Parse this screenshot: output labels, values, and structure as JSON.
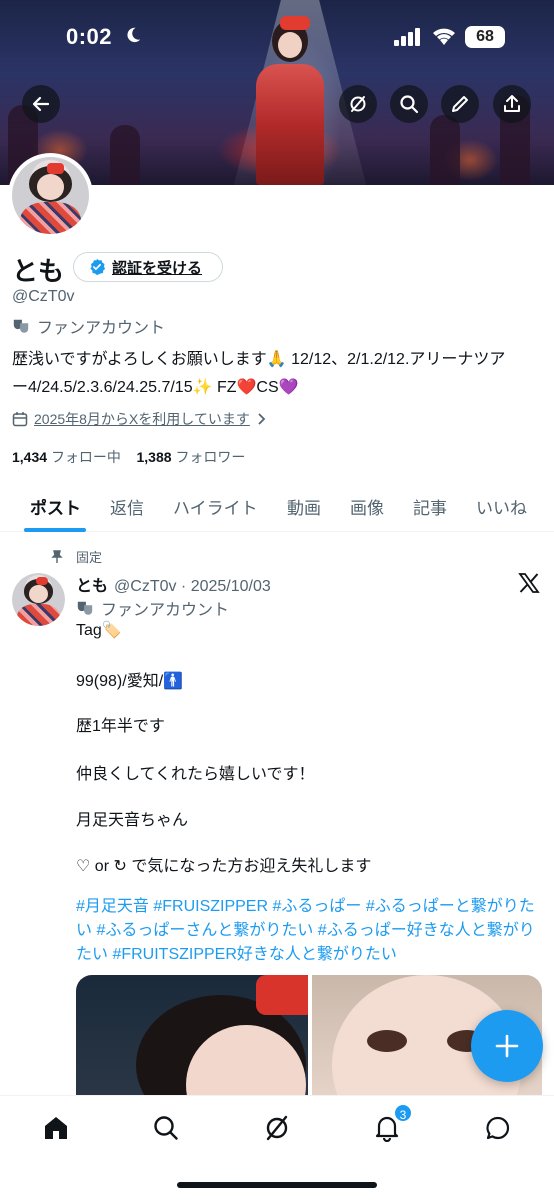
{
  "status_bar": {
    "time": "0:02",
    "battery": "68"
  },
  "profile": {
    "name": "とも",
    "verify_label": "認証を受ける",
    "handle": "@CzT0v",
    "account_type": "ファンアカウント",
    "bio_line1": "歴浅いですがよろしくお願いします🙏 12/12、2/1.2/12.アリーナツア",
    "bio_line2": "ー4/24.5/2.3.6/24.25.7/15✨ FZ❤️CS💜",
    "joined": "2025年8月からXを利用しています",
    "following_count": "1,434",
    "following_label": "フォロー中",
    "followers_count": "1,388",
    "followers_label": "フォロワー"
  },
  "tabs": [
    "ポスト",
    "返信",
    "ハイライト",
    "動画",
    "画像",
    "記事",
    "いいね"
  ],
  "post": {
    "pinned_label": "固定",
    "author_name": "とも",
    "author_meta": "@CzT0v · 2025/10/03",
    "account_type": "ファンアカウント",
    "lines": [
      "Tag🏷️",
      "99(98)/愛知/🚹",
      "歴1年半です",
      "仲良くしてくれたら嬉しいです！",
      "月足天音ちゃん",
      "♡ or ↻ で気になった方お迎え失礼します"
    ],
    "hashtags": "#月足天音 #FRUISZIPPER #ふるっぱー #ふるっぱーと繋がりたい #ふるっぱーさんと繋がりたい #ふるっぱー好きな人と繋がりたい #FRUITSZIPPER好きな人と繋がりたい"
  },
  "bottom_nav": {
    "notification_count": "3"
  },
  "colors": {
    "accent": "#1d9bf0",
    "text": "#0f1419",
    "secondary": "#536471"
  },
  "icons": [
    "back-arrow-icon",
    "grok-icon",
    "search-icon",
    "edit-icon",
    "share-icon",
    "verified-badge-icon",
    "fan-mask-icon",
    "calendar-icon",
    "chevron-right-icon",
    "pin-icon",
    "x-logo-icon",
    "plus-icon",
    "home-icon",
    "bell-icon",
    "messages-icon"
  ]
}
